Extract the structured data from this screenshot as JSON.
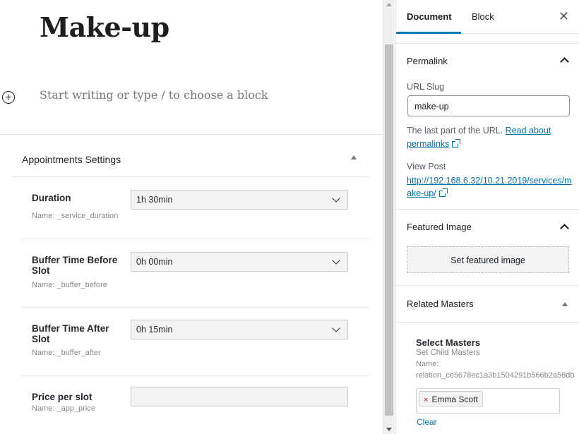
{
  "editor": {
    "post_title": "Make-up",
    "block_placeholder": "Start writing or type / to choose a block"
  },
  "metabox": {
    "title": "Appointments Settings",
    "fields": [
      {
        "label": "Duration",
        "hint": "Name: _service_duration",
        "value": "1h 30min"
      },
      {
        "label": "Buffer Time Before Slot",
        "hint": "Name: _buffer_before",
        "value": "0h 00min"
      },
      {
        "label": "Buffer Time After Slot",
        "hint": "Name: _buffer_after",
        "value": "0h 15min"
      },
      {
        "label": "Price per slot",
        "hint": "Name: _app_price",
        "value": ""
      }
    ]
  },
  "sidebar": {
    "tabs": {
      "document": "Document",
      "block": "Block"
    },
    "close_symbol": "✕",
    "permalink": {
      "title": "Permalink",
      "url_slug_label": "URL Slug",
      "slug_value": "make-up",
      "help_text": "The last part of the URL.",
      "help_link": "Read about permalinks",
      "view_post_label": "View Post",
      "view_post_url": "http://192.168.6.32/10.21.2019/services/make-up/"
    },
    "featured_image": {
      "title": "Featured Image",
      "button": "Set featured image"
    },
    "related_masters": {
      "title": "Related Masters",
      "select_title": "Select Masters",
      "subtitle": "Set Child Masters",
      "name_label": "Name:",
      "name_value": "relation_ce5678ec1a3b1504291b566b2a58db",
      "chip_label": "Emma Scott",
      "chip_remove": "×",
      "clear_label": "Clear"
    }
  },
  "colors": {
    "accent": "#007cba",
    "link": "#0073aa"
  }
}
